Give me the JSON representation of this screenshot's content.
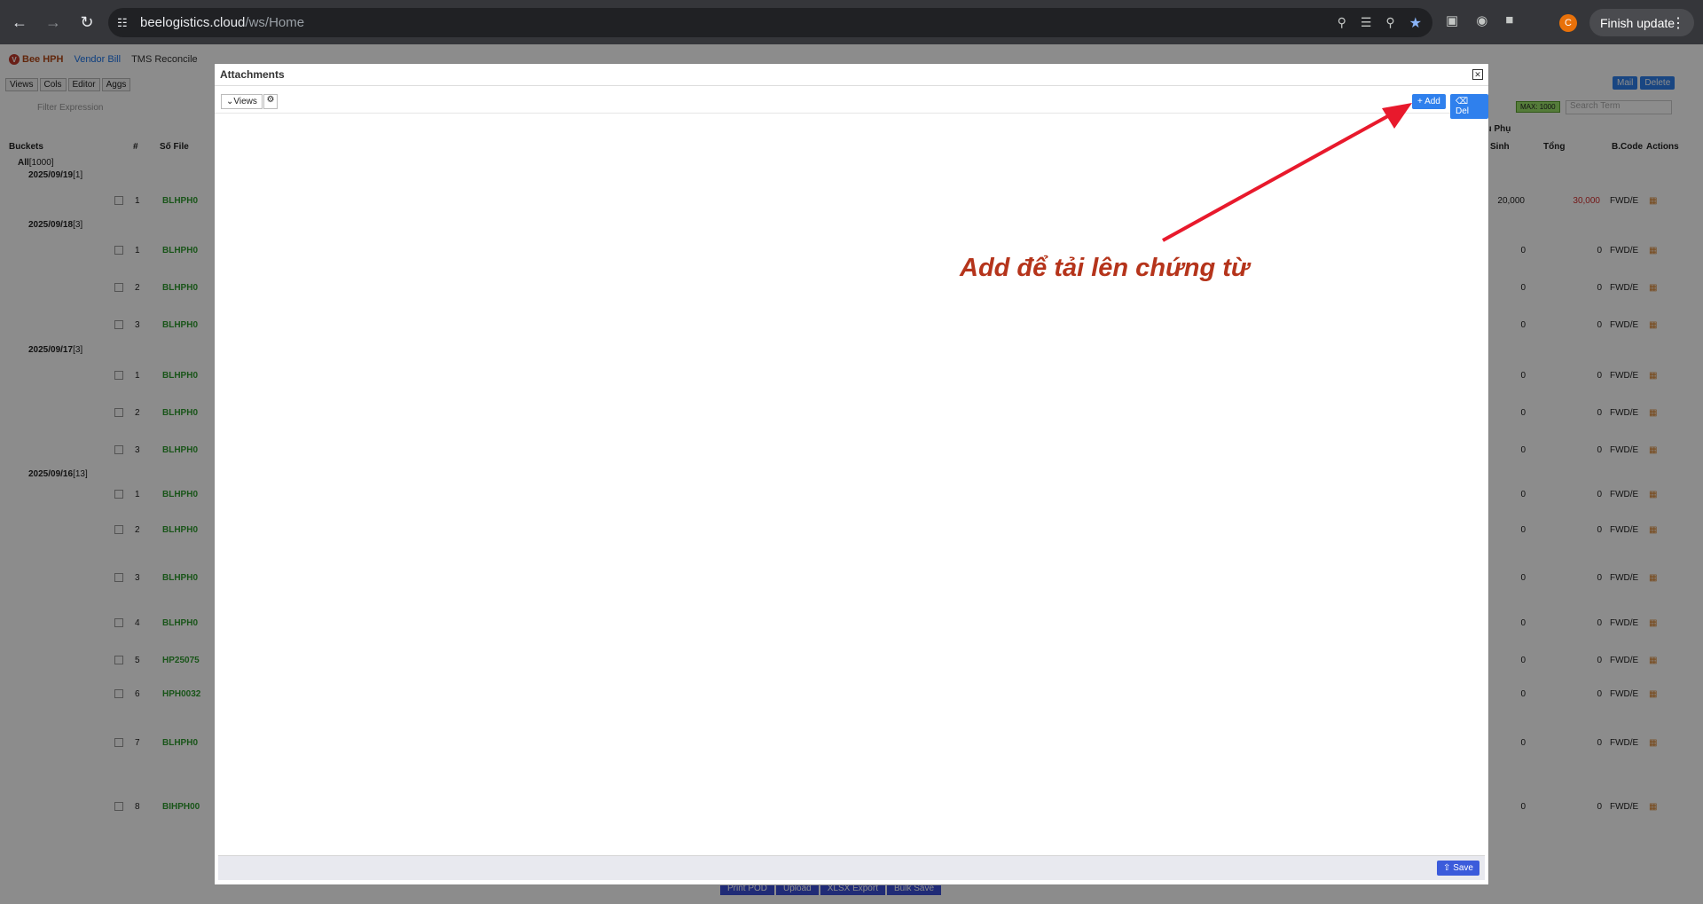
{
  "browser": {
    "url_host": "beelogistics.cloud",
    "url_path": "/ws/Home",
    "finish_update": "Finish update",
    "profile_initial": "C"
  },
  "app": {
    "brand": "Bee HPH",
    "tabs": [
      "Vendor Bill",
      "TMS Reconcile"
    ],
    "tools": [
      "Views",
      "Cols",
      "Editor",
      "Aggs"
    ],
    "filter_placeholder": "Filter Expression",
    "max_badge": "MAX: 1000",
    "search_placeholder": "Search Term",
    "mail_label": "Mail",
    "delete_label": "Delete",
    "columns": {
      "buckets": "Buckets",
      "hash": "#",
      "so_file": "Số File",
      "phu_group": "ầu Phụ",
      "sinh": "Sinh",
      "tong": "Tổng",
      "bcode": "B.Code",
      "actions": "Actions"
    },
    "all_bucket": "All",
    "all_count": "[1000]",
    "buckets": [
      {
        "date": "2025/09/19",
        "count": "[1]"
      },
      {
        "date": "2025/09/18",
        "count": "[3]"
      },
      {
        "date": "2025/09/17",
        "count": "[3]"
      },
      {
        "date": "2025/09/16",
        "count": "[13]"
      }
    ],
    "rows": [
      {
        "num": "1",
        "file": "BLHPH0",
        "v1": "20,000",
        "v2": "30,000",
        "fwd": "FWD/E"
      },
      {
        "num": "1",
        "file": "BLHPH0",
        "v1": "0",
        "v2": "0",
        "fwd": "FWD/E"
      },
      {
        "num": "2",
        "file": "BLHPH0",
        "v1": "0",
        "v2": "0",
        "fwd": "FWD/E"
      },
      {
        "num": "3",
        "file": "BLHPH0",
        "v1": "0",
        "v2": "0",
        "fwd": "FWD/E"
      },
      {
        "num": "1",
        "file": "BLHPH0",
        "v1": "0",
        "v2": "0",
        "fwd": "FWD/E"
      },
      {
        "num": "2",
        "file": "BLHPH0",
        "v1": "0",
        "v2": "0",
        "fwd": "FWD/E"
      },
      {
        "num": "3",
        "file": "BLHPH0",
        "v1": "0",
        "v2": "0",
        "fwd": "FWD/E"
      },
      {
        "num": "1",
        "file": "BLHPH0",
        "v1": "0",
        "v2": "0",
        "fwd": "FWD/E"
      },
      {
        "num": "2",
        "file": "BLHPH0",
        "v1": "0",
        "v2": "0",
        "fwd": "FWD/E"
      },
      {
        "num": "3",
        "file": "BLHPH0",
        "v1": "0",
        "v2": "0",
        "fwd": "FWD/E"
      },
      {
        "num": "4",
        "file": "BLHPH0",
        "v1": "0",
        "v2": "0",
        "fwd": "FWD/E"
      },
      {
        "num": "5",
        "file": "HP25075",
        "v1": "0",
        "v2": "0",
        "fwd": "FWD/E"
      },
      {
        "num": "6",
        "file": "HPH0032",
        "v1": "0",
        "v2": "0",
        "fwd": "FWD/E"
      },
      {
        "num": "7",
        "file": "BLHPH0",
        "v1": "0",
        "v2": "0",
        "fwd": "FWD/E"
      },
      {
        "num": "8",
        "file": "BIHPH00",
        "v1": "0",
        "v2": "0",
        "fwd": "FWD/E"
      }
    ],
    "bottom_buttons": [
      "Print POD",
      "Upload",
      "XLSX Export",
      "Bulk Save"
    ]
  },
  "modal": {
    "title": "Attachments",
    "views_label": "Views",
    "add_label": "Add",
    "del_label": "Del",
    "save_label": "Save"
  },
  "annotation": {
    "text": "Add để tải lên chứng từ",
    "color": "#b5341b",
    "arrow_color": "#e8192c"
  }
}
